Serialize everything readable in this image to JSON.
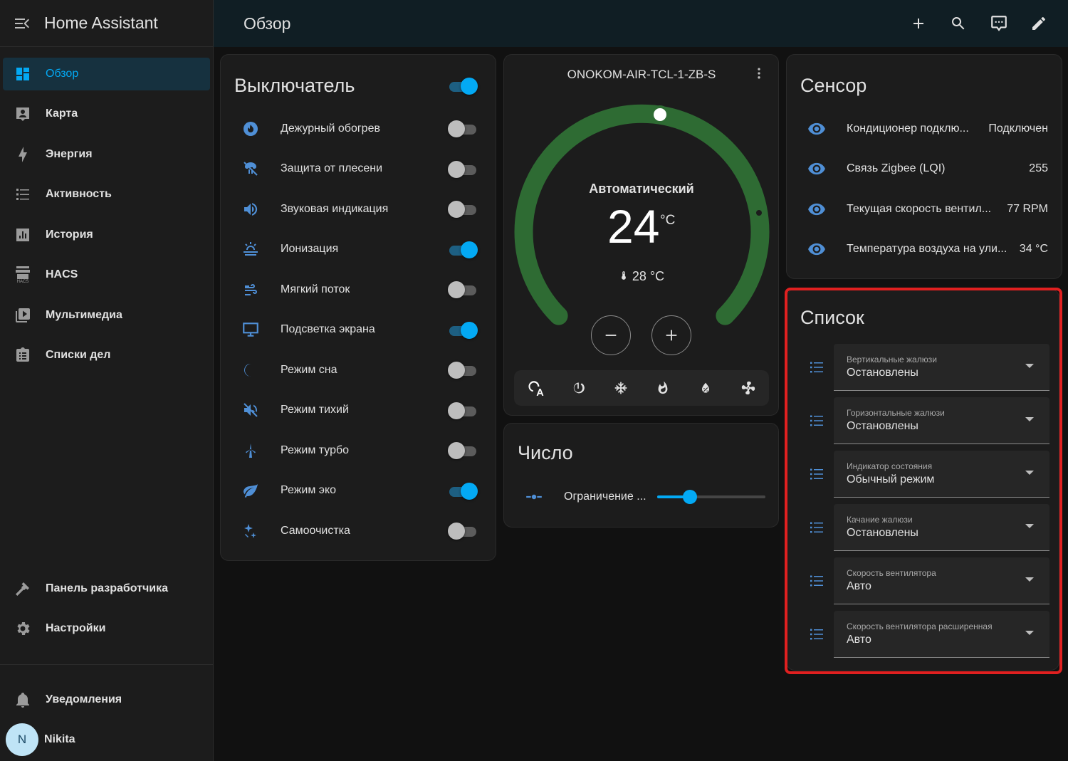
{
  "app": {
    "title": "Home Assistant"
  },
  "sidebar": {
    "items": [
      {
        "label": "Обзор",
        "icon": "view-dashboard-icon"
      },
      {
        "label": "Карта",
        "icon": "map-account-icon"
      },
      {
        "label": "Энергия",
        "icon": "lightning-bolt-icon"
      },
      {
        "label": "Активность",
        "icon": "format-list-bulleted-icon"
      },
      {
        "label": "История",
        "icon": "chart-box-icon"
      },
      {
        "label": "HACS",
        "icon": "hacs-icon"
      },
      {
        "label": "Мультимедиа",
        "icon": "play-box-multiple-icon"
      },
      {
        "label": "Списки дел",
        "icon": "clipboard-list-icon"
      }
    ],
    "bottom": [
      {
        "label": "Панель разработчика",
        "icon": "hammer-icon"
      },
      {
        "label": "Настройки",
        "icon": "cog-icon"
      }
    ],
    "notifications": {
      "label": "Уведомления",
      "icon": "bell-icon"
    },
    "user": {
      "name": "Nikita",
      "initial": "N"
    },
    "hacs_small": "HACS"
  },
  "header": {
    "title": "Обзор"
  },
  "switch_card": {
    "title": "Выключатель",
    "master_on": true,
    "items": [
      {
        "label": "Дежурный обогрев",
        "on": false
      },
      {
        "label": "Защита от плесени",
        "on": false
      },
      {
        "label": "Звуковая индикация",
        "on": false
      },
      {
        "label": "Ионизация",
        "on": true
      },
      {
        "label": "Мягкий поток",
        "on": false
      },
      {
        "label": "Подсветка экрана",
        "on": true
      },
      {
        "label": "Режим сна",
        "on": false
      },
      {
        "label": "Режим тихий",
        "on": false
      },
      {
        "label": "Режим турбо",
        "on": false
      },
      {
        "label": "Режим эко",
        "on": true
      },
      {
        "label": "Самоочистка",
        "on": false
      }
    ]
  },
  "climate": {
    "name": "ONOKOM-AIR-TCL-1-ZB-S",
    "mode": "Автоматический",
    "target": "24",
    "unit": "°C",
    "current": "28 °C",
    "modes": [
      "auto",
      "off",
      "cool",
      "heat",
      "dry",
      "fan"
    ],
    "active_mode": 0
  },
  "number_card": {
    "title": "Число",
    "label": "Ограничение ...",
    "value_fraction": 0.3
  },
  "sensor_card": {
    "title": "Сенсор",
    "items": [
      {
        "label": "Кондиционер подклю...",
        "value": "Подключен"
      },
      {
        "label": "Связь Zigbee (LQI)",
        "value": "255"
      },
      {
        "label": "Текущая скорость вентил...",
        "value": "77 RPM"
      },
      {
        "label": "Температура воздуха на ули...",
        "value": "34 °C"
      }
    ]
  },
  "select_card": {
    "title": "Список",
    "items": [
      {
        "label": "Вертикальные жалюзи",
        "value": "Остановлены"
      },
      {
        "label": "Горизонтальные жалюзи",
        "value": "Остановлены"
      },
      {
        "label": "Индикатор состояния",
        "value": "Обычный режим"
      },
      {
        "label": "Качание жалюзи",
        "value": "Остановлены"
      },
      {
        "label": "Скорость вентилятора",
        "value": "Авто"
      },
      {
        "label": "Скорость вентилятора расширенная",
        "value": "Авто"
      }
    ]
  },
  "colors": {
    "accent": "#03a9f4",
    "climate_arc": "#2e6b33",
    "auto_mode": "#43a047",
    "highlight": "#e02020"
  }
}
